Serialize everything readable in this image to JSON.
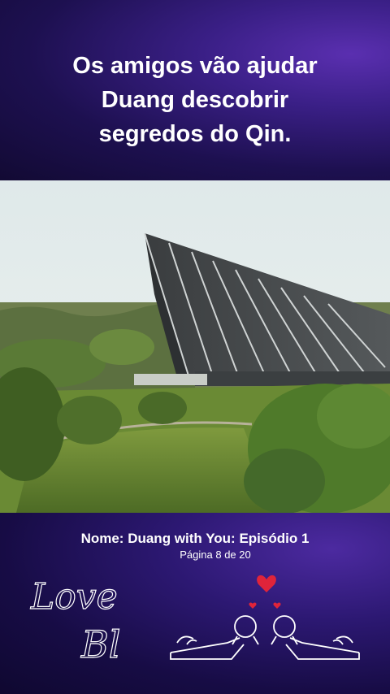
{
  "header": {
    "headline_line1": "Os amigos vão ajudar",
    "headline_line2": "Duang descobrir",
    "headline_line3": "segredos do Qin."
  },
  "footer": {
    "name": "Nome: Duang with You: Episódio 1",
    "page": "Página 8 de 20",
    "logo_text_line1": "Love",
    "logo_text_line2": "Bl"
  },
  "colors": {
    "background_top": "#1d1050",
    "accent_purple": "#5a2fb0",
    "heart_red": "#e0243a"
  },
  "icons": [
    "heart-icon",
    "couple-lying-illustration"
  ]
}
